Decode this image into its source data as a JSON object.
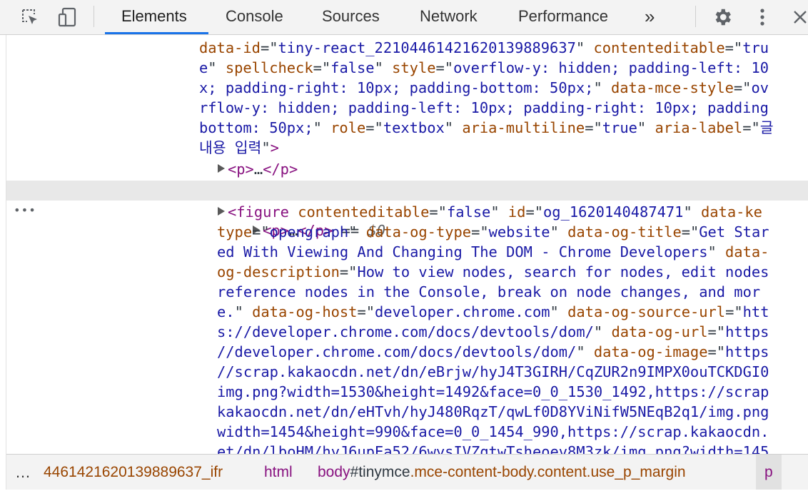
{
  "toolbar": {
    "icons": [
      "inspect-element-icon",
      "device-toggle-icon",
      "gear-icon",
      "more-vertical-icon",
      "close-icon"
    ],
    "tabs": [
      {
        "label": "Elements",
        "active": true
      },
      {
        "label": "Console"
      },
      {
        "label": "Sources"
      },
      {
        "label": "Network"
      },
      {
        "label": "Performance"
      }
    ],
    "more_tabs": "»"
  },
  "dom_tree": {
    "lines": [
      {
        "indent": "0",
        "segments": [
          [
            "an",
            "data-id"
          ],
          [
            "pl",
            "=\""
          ],
          [
            "av",
            "tiny-react_22104461421620139889637"
          ],
          [
            "pl",
            "\" "
          ],
          [
            "an",
            "contenteditable"
          ],
          [
            "pl",
            "=\""
          ],
          [
            "av",
            "tru"
          ]
        ]
      },
      {
        "segments": [
          [
            "av",
            "e"
          ],
          [
            "pl",
            "\" "
          ],
          [
            "an",
            "spellcheck"
          ],
          [
            "pl",
            "=\""
          ],
          [
            "av",
            "false"
          ],
          [
            "pl",
            "\" "
          ],
          [
            "an",
            "style"
          ],
          [
            "pl",
            "=\""
          ],
          [
            "av",
            "overflow-y: hidden; padding-left: 10"
          ]
        ]
      },
      {
        "segments": [
          [
            "av",
            "x; padding-right: 10px; padding-bottom: 50px;"
          ],
          [
            "pl",
            "\" "
          ],
          [
            "an",
            "data-mce-style"
          ],
          [
            "pl",
            "=\""
          ],
          [
            "av",
            "ov"
          ]
        ]
      },
      {
        "segments": [
          [
            "av",
            "rflow-y: hidden; padding-left: 10px; padding-right: 10px; padding"
          ]
        ]
      },
      {
        "segments": [
          [
            "av",
            "bottom: 50px;"
          ],
          [
            "pl",
            "\" "
          ],
          [
            "an",
            "role"
          ],
          [
            "pl",
            "=\""
          ],
          [
            "av",
            "textbox"
          ],
          [
            "pl",
            "\" "
          ],
          [
            "an",
            "aria-multiline"
          ],
          [
            "pl",
            "=\""
          ],
          [
            "av",
            "true"
          ],
          [
            "pl",
            "\" "
          ],
          [
            "an",
            "aria-label"
          ],
          [
            "pl",
            "=\""
          ],
          [
            "av",
            "글"
          ]
        ]
      },
      {
        "segments": [
          [
            "av",
            "내용 입력"
          ],
          [
            "pl",
            "\""
          ],
          [
            "tg",
            ">"
          ]
        ]
      },
      {
        "segments": [
          [
            "tg",
            "<p>"
          ],
          [
            "pl",
            "…"
          ],
          [
            "tg",
            "</p>"
          ]
        ]
      },
      {
        "segments": [
          [
            "tg",
            "<p>"
          ],
          [
            "pl",
            "…"
          ],
          [
            "tg",
            "</p>"
          ],
          [
            "pl",
            " == "
          ],
          [
            "sel",
            "$0"
          ]
        ]
      },
      {
        "segments": [
          [
            "tg",
            "<figure "
          ],
          [
            "an",
            "contenteditable"
          ],
          [
            "pl",
            "=\""
          ],
          [
            "av",
            "false"
          ],
          [
            "pl",
            "\" "
          ],
          [
            "an",
            "id"
          ],
          [
            "pl",
            "=\""
          ],
          [
            "av",
            "og_1620140487471"
          ],
          [
            "pl",
            "\" "
          ],
          [
            "an",
            "data-ke"
          ]
        ]
      },
      {
        "segments": [
          [
            "an",
            "type"
          ],
          [
            "pl",
            "=\""
          ],
          [
            "av",
            "opengraph"
          ],
          [
            "pl",
            "\" "
          ],
          [
            "an",
            "data-og-type"
          ],
          [
            "pl",
            "=\""
          ],
          [
            "av",
            "website"
          ],
          [
            "pl",
            "\" "
          ],
          [
            "an",
            "data-og-title"
          ],
          [
            "pl",
            "=\""
          ],
          [
            "av",
            "Get Star"
          ]
        ]
      },
      {
        "segments": [
          [
            "av",
            "ed With Viewing And Changing The DOM - Chrome Developers"
          ],
          [
            "pl",
            "\" "
          ],
          [
            "an",
            "data-"
          ]
        ]
      },
      {
        "segments": [
          [
            "an",
            "og-description"
          ],
          [
            "pl",
            "=\""
          ],
          [
            "av",
            "How to view nodes, search for nodes, edit nodes"
          ]
        ]
      },
      {
        "segments": [
          [
            "av",
            "reference nodes in the Console, break on node changes, and mor"
          ]
        ]
      },
      {
        "segments": [
          [
            "av",
            "e."
          ],
          [
            "pl",
            "\" "
          ],
          [
            "an",
            "data-og-host"
          ],
          [
            "pl",
            "=\""
          ],
          [
            "av",
            "developer.chrome.com"
          ],
          [
            "pl",
            "\" "
          ],
          [
            "an",
            "data-og-source-url"
          ],
          [
            "pl",
            "=\""
          ],
          [
            "av",
            "htt"
          ]
        ]
      },
      {
        "segments": [
          [
            "av",
            "s://developer.chrome.com/docs/devtools/dom/"
          ],
          [
            "pl",
            "\" "
          ],
          [
            "an",
            "data-og-url"
          ],
          [
            "pl",
            "=\""
          ],
          [
            "av",
            "https"
          ]
        ]
      },
      {
        "segments": [
          [
            "av",
            "//developer.chrome.com/docs/devtools/dom/"
          ],
          [
            "pl",
            "\" "
          ],
          [
            "an",
            "data-og-image"
          ],
          [
            "pl",
            "=\""
          ],
          [
            "av",
            "https"
          ]
        ]
      },
      {
        "segments": [
          [
            "av",
            "//scrap.kakaocdn.net/dn/eBrjw/hyJ4T3GIRH/CqZUR2n9IMPX0ouTCKDGI0"
          ]
        ]
      },
      {
        "segments": [
          [
            "av",
            "img.png?width=1530&height=1492&face=0_0_1530_1492,https://scrap"
          ]
        ]
      },
      {
        "segments": [
          [
            "av",
            "kakaocdn.net/dn/eHTvh/hyJ480RqzT/qwLf0D8YViNifW5NEqB2q1/img.png"
          ]
        ]
      },
      {
        "segments": [
          [
            "av",
            "width=1454&height=990&face=0_0_1454_990,https://scrap.kakaocdn."
          ]
        ]
      },
      {
        "segments": [
          [
            "av",
            "et/dn/lboHM/hyJ6upEa52/6wysIVZqtwTsheoev8M3zk/img.png?width=145"
          ]
        ]
      }
    ]
  },
  "breadcrumb": {
    "more": "…",
    "items": [
      {
        "kind": "trunc",
        "text": "446142162013988963​7_ifr"
      },
      {
        "kind": "tag",
        "text": "html"
      },
      {
        "kind": "body",
        "tag": "body",
        "id": "#tinymce",
        "cls": ".mce-content-body.content.use_p_margin"
      },
      {
        "kind": "last",
        "text": "p"
      }
    ]
  }
}
